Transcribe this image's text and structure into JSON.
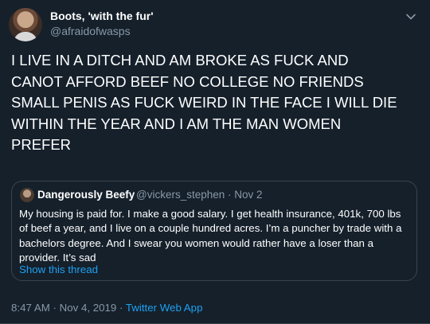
{
  "author": {
    "name": "Boots, 'with the fur'",
    "handle": "@afraidofwasps"
  },
  "tweet_text": "I LIVE IN A DITCH AND AM BROKE AS FUCK AND\nCANOT AFFORD BEEF  NO COLLEGE  NO FRIENDS\nSMALL PENIS AS FUCK  WEIRD IN THE FACE  I WILL DIE\nWITHIN THE YEAR  AND I AM THE MAN WOMEN\nPREFER",
  "quoted": {
    "name": "Dangerously Beefy",
    "handle_date": "@vickers_stephen · Nov 2",
    "text": "My housing is paid for. I make a good salary. I get health insurance, 401k, 700 lbs\nof beef a year, and I live on a couple hundred acres. I’m a puncher by trade with a\nbachelors degree. And I swear you women would rather have a loser than a\nprovider. It’s sad",
    "show_thread": "Show this thread"
  },
  "meta": {
    "timestamp": "8:47 AM · Nov 4, 2019 · ",
    "source": "Twitter Web App"
  },
  "colors": {
    "background": "#15202b",
    "secondary_text": "#8899a6",
    "accent": "#1da1f2",
    "border": "#38444d"
  },
  "icons": {
    "more": "chevron-down-icon"
  }
}
